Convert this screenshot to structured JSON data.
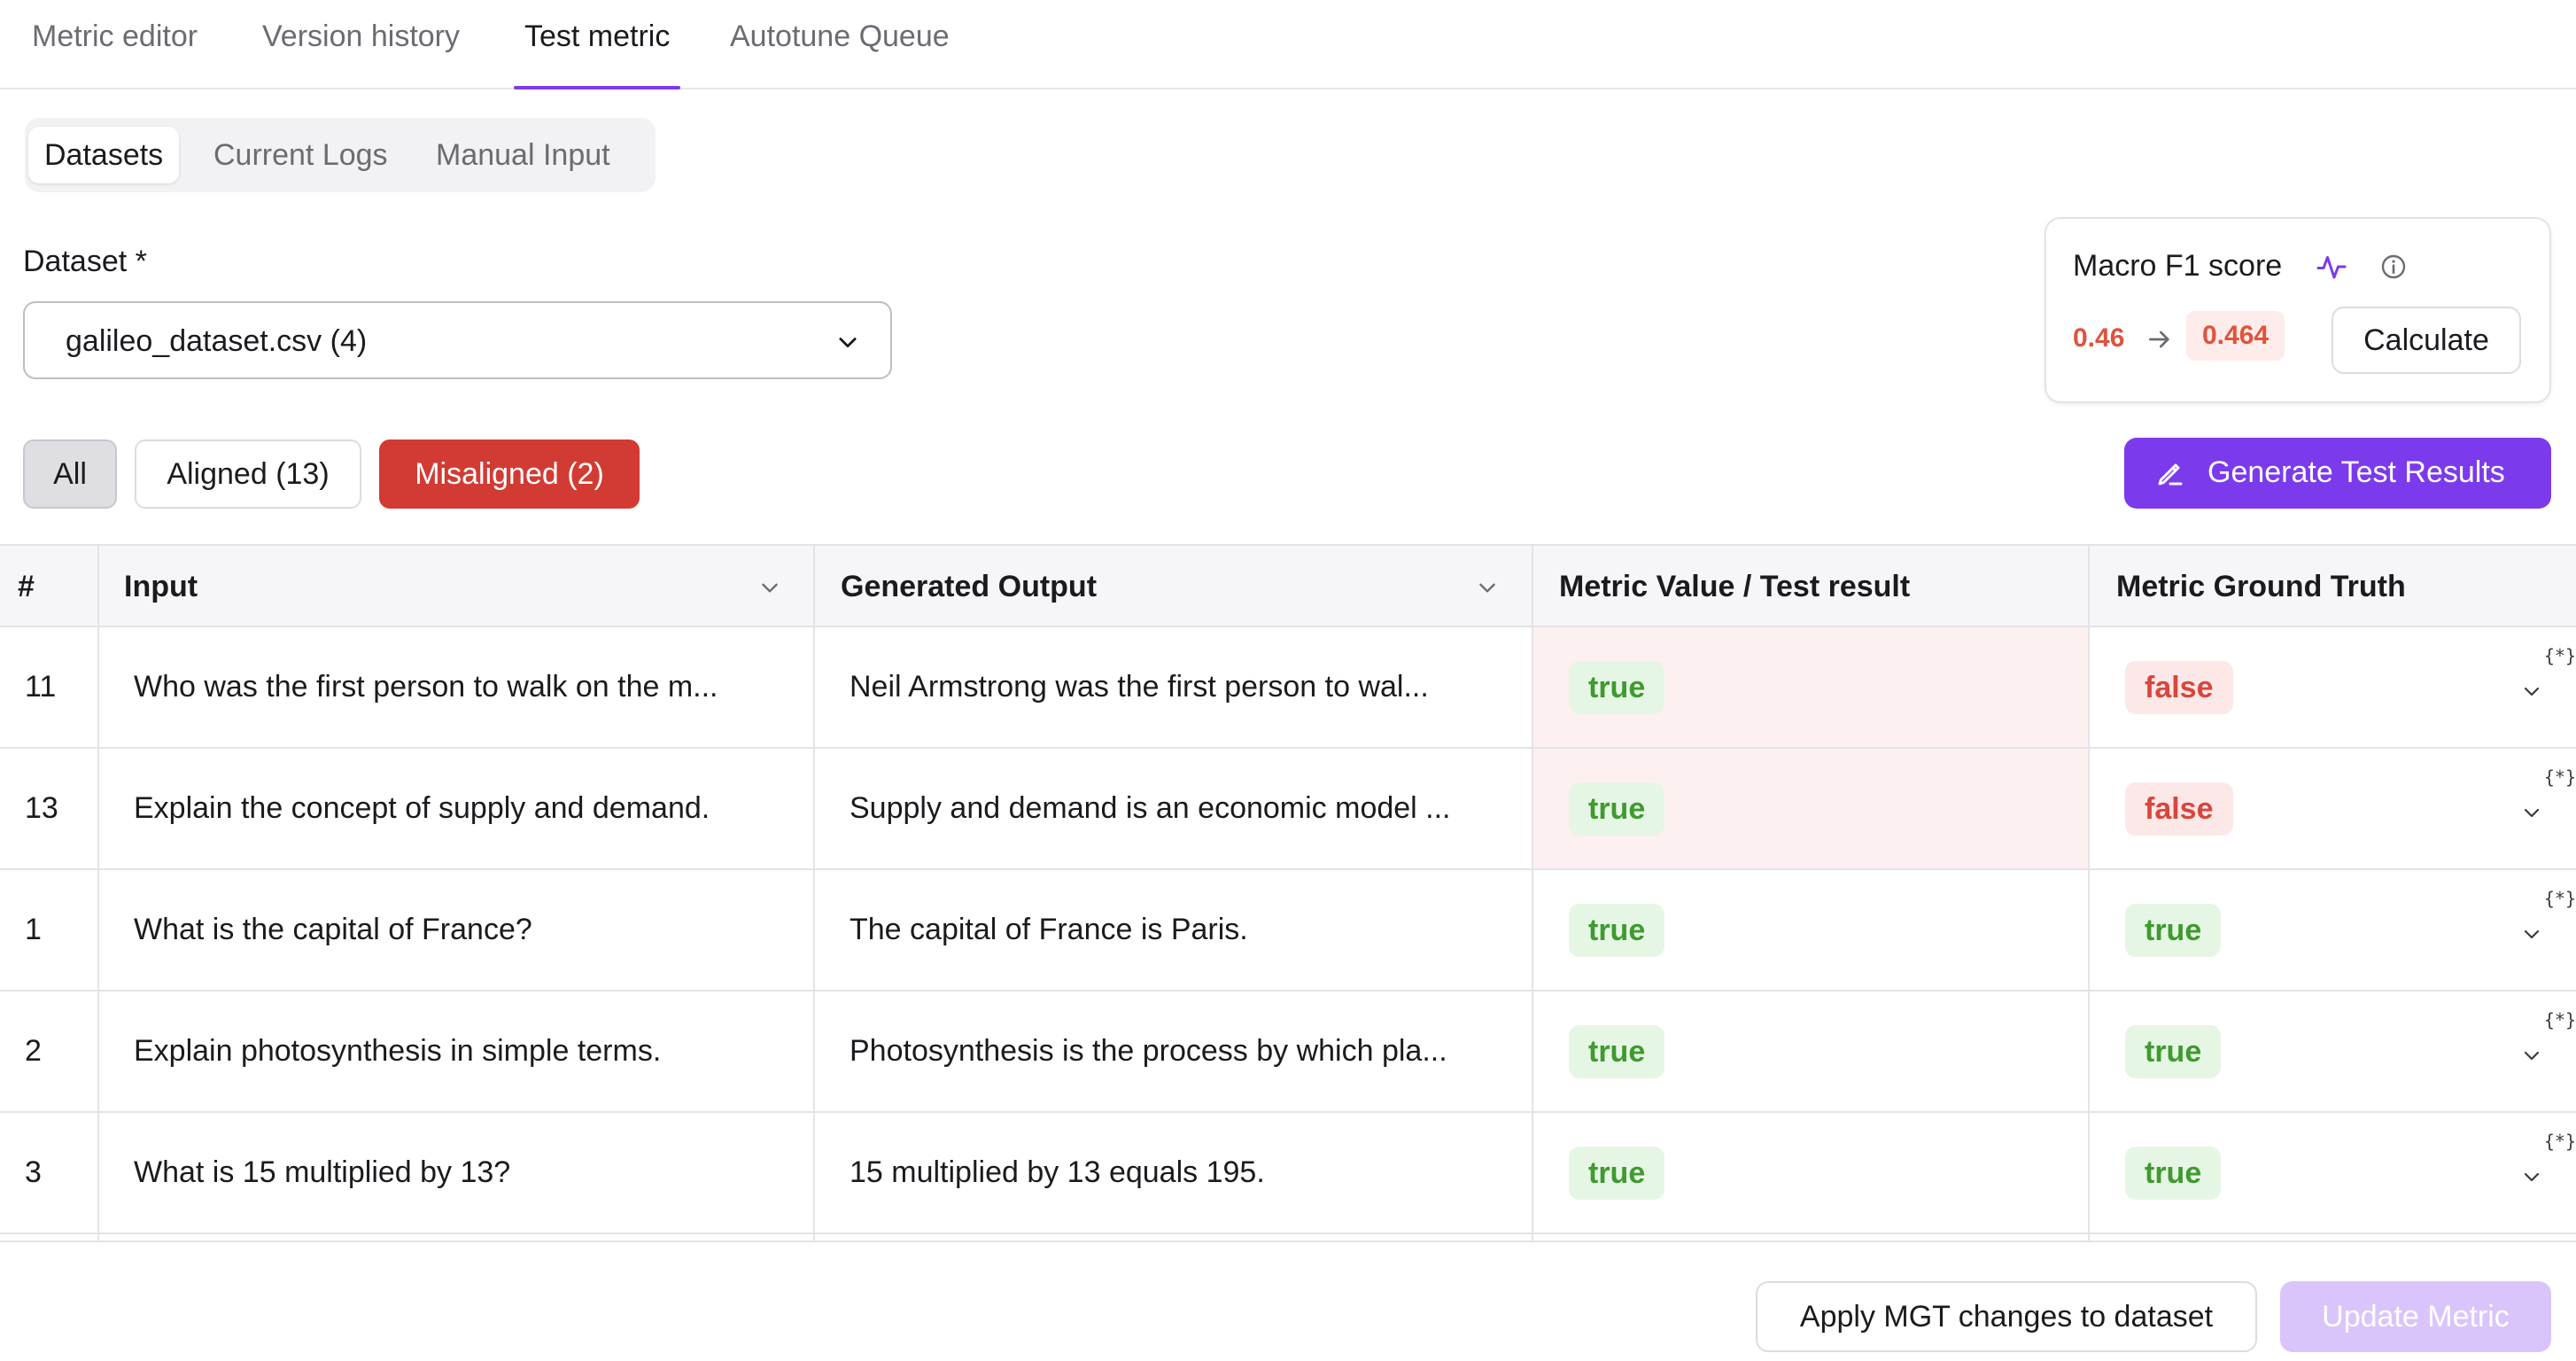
{
  "top_tabs": [
    {
      "label": "Metric editor"
    },
    {
      "label": "Version history"
    },
    {
      "label": "Test metric",
      "active": true
    },
    {
      "label": "Autotune Queue"
    }
  ],
  "sub_tabs": [
    {
      "label": "Datasets",
      "active": true
    },
    {
      "label": "Current Logs"
    },
    {
      "label": "Manual Input"
    }
  ],
  "dataset": {
    "label": "Dataset *",
    "value": "galileo_dataset.csv (4)"
  },
  "score": {
    "title": "Macro F1 score",
    "old_value": "0.46",
    "new_value": "0.464",
    "calculate_label": "Calculate"
  },
  "filters": {
    "all": "All",
    "aligned": "Aligned (13)",
    "misaligned": "Misaligned (2)"
  },
  "generate_label": "Generate Test Results",
  "table": {
    "headers": {
      "num": "#",
      "input": "Input",
      "output": "Generated Output",
      "metric": "Metric Value / Test result",
      "gt": "Metric Ground Truth"
    },
    "code_icon": "{*}",
    "rows": [
      {
        "num": "11",
        "input": "Who was the first person to walk on the m...",
        "output": "Neil Armstrong was the first person to wal...",
        "metric": "true",
        "gt": "false",
        "misaligned": true
      },
      {
        "num": "13",
        "input": "Explain the concept of supply and demand.",
        "output": "Supply and demand is an economic model ...",
        "metric": "true",
        "gt": "false",
        "misaligned": true
      },
      {
        "num": "1",
        "input": "What is the capital of France?",
        "output": "The capital of France is Paris.",
        "metric": "true",
        "gt": "true",
        "misaligned": false
      },
      {
        "num": "2",
        "input": "Explain photosynthesis in simple terms.",
        "output": "Photosynthesis is the process by which pla...",
        "metric": "true",
        "gt": "true",
        "misaligned": false
      },
      {
        "num": "3",
        "input": "What is 15 multiplied by 13?",
        "output": "15 multiplied by 13 equals 195.",
        "metric": "true",
        "gt": "true",
        "misaligned": false
      }
    ]
  },
  "bottom": {
    "apply_label": "Apply MGT changes to dataset",
    "update_label": "Update Metric"
  },
  "colors": {
    "accent": "#7c3aed",
    "danger": "#d23b33",
    "success": "#3f9a2f"
  }
}
